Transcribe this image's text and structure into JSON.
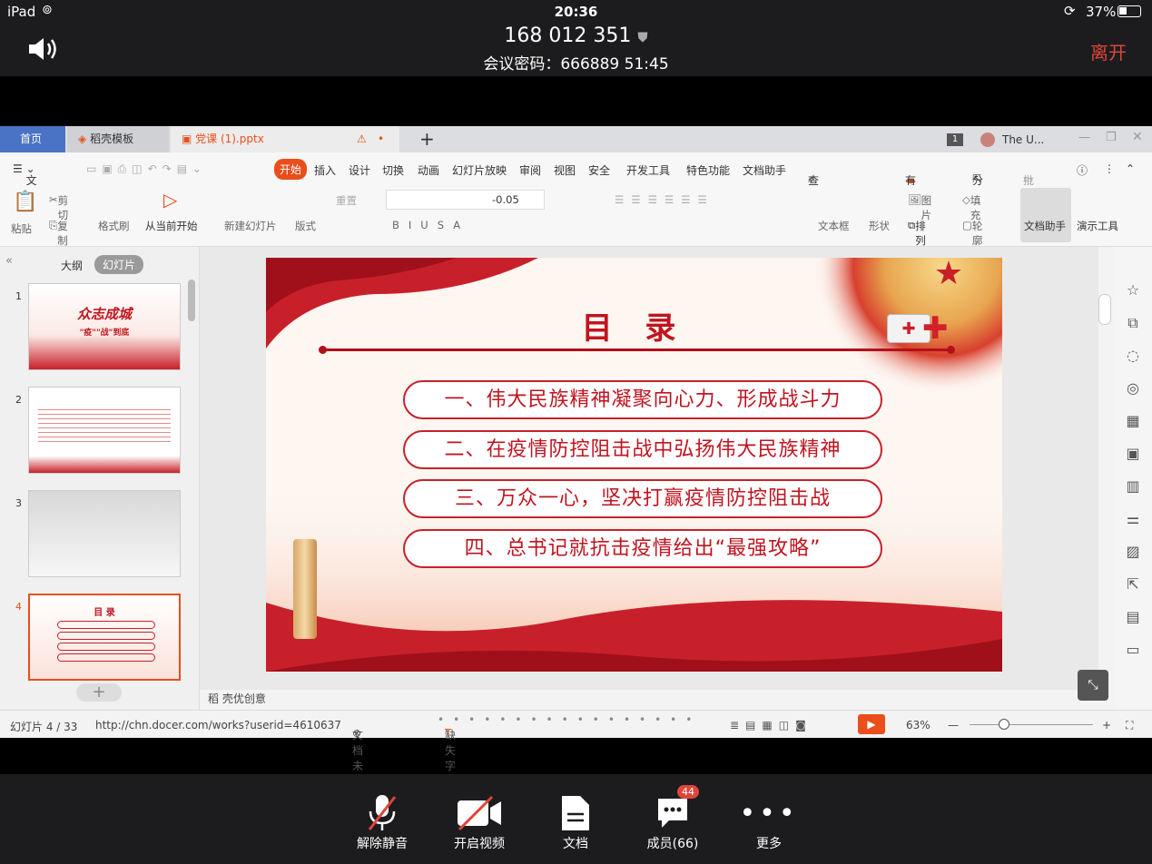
{
  "status": {
    "device": "iPad",
    "time": "20:36",
    "battery": "37%"
  },
  "meeting": {
    "id": "168 012 351",
    "password_line": "会议密码：666889  51:45",
    "leave": "离开"
  },
  "tabs": {
    "home": "首页",
    "template": "稻壳模板",
    "file": "党课 (1).pptx",
    "user": "The U...",
    "badge": "1"
  },
  "menu": {
    "file": "文件",
    "start": "开始",
    "insert": "插入",
    "design": "设计",
    "switch": "切换",
    "anim": "动画",
    "show": "幻灯片放映",
    "review": "审阅",
    "view": "视图",
    "safe": "安全",
    "dev": "开发工具",
    "special": "特色功能",
    "doc_helper": "文档助手",
    "search": "查找命令...",
    "anomaly": "有异常",
    "share": "分享",
    "comment": "批注"
  },
  "ribbon": {
    "paste": "粘贴",
    "cut": "剪切",
    "copy": "复制",
    "format": "格式刷",
    "from_current": "从当前开始",
    "new_slide": "新建幻灯片",
    "layout": "版式",
    "reset": "重置",
    "spacing": "-0.05",
    "textbox": "文本框",
    "shape": "形状",
    "picture": "图片",
    "fill": "填充",
    "arrange": "排列",
    "outline": "轮廓",
    "doc_helper": "文档助手",
    "present": "演示工具"
  },
  "panel": {
    "outline": "大纲",
    "slides": "幻灯片",
    "thumb1_title": "众志成城",
    "thumb1_sub": "\"疫\"\"战\"到底",
    "thumb4_title": "目 录"
  },
  "slide": {
    "title": "目 录",
    "items": [
      "一、伟大民族精神凝聚向心力、形成战斗力",
      "二、在疫情防控阻击战中弘扬伟大民族精神",
      "三、万众一心，坚决打赢疫情防控阻击战",
      "四、总书记就抗击疫情给出“最强攻略”"
    ]
  },
  "notes": "稻 壳优创意",
  "statusline": {
    "slide_count": "幻灯片 4 / 33",
    "url": "http://chn.docer.com/works?userid=4610637",
    "unprotected": "文档未保护",
    "missing_font": "缺失字体",
    "zoom": "63%"
  },
  "bottom": {
    "unmute": "解除静音",
    "video": "开启视频",
    "docs": "文档",
    "members": "成员(66)",
    "members_badge": "44",
    "more": "更多"
  },
  "colors": {
    "accent": "#e94e1b",
    "slide_red": "#c0141f",
    "leave": "#e0453a"
  }
}
